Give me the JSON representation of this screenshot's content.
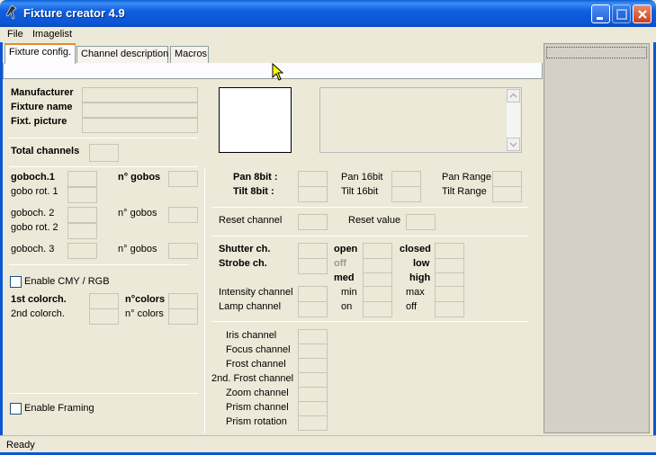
{
  "window": {
    "title": "Fixture creator 4.9"
  },
  "menu": [
    "File",
    "Imagelist"
  ],
  "tabs": [
    "Fixture config.",
    "Channel description",
    "Macros"
  ],
  "general": {
    "manufacturer": "Manufacturer",
    "fixture_name": "Fixture name",
    "fixture_picture": "Fixt. picture",
    "total_channels": "Total channels"
  },
  "gobo": {
    "goboch1": "goboch.1",
    "gobo_rot1": "gobo rot. 1",
    "n_gobos_1": "n° gobos",
    "goboch2": "goboch. 2",
    "gobo_rot2": "gobo rot. 2",
    "n_gobos_2": "n° gobos",
    "goboch3": "goboch. 3",
    "n_gobos_3": "n° gobos"
  },
  "color": {
    "enable_cmy": "Enable CMY / RGB",
    "colorch1": "1st colorch.",
    "colorch2": "2nd colorch.",
    "ncolors1": "n°colors",
    "ncolors2": "n° colors"
  },
  "framing": {
    "enable": "Enable Framing"
  },
  "pantilt": {
    "pan8": "Pan 8bit :",
    "tilt8": "Tilt 8bit :",
    "pan16": "Pan 16bit",
    "tilt16": "Tilt 16bit",
    "pan_range": "Pan Range",
    "tilt_range": "Tilt Range"
  },
  "reset": {
    "channel": "Reset channel",
    "value": "Reset value"
  },
  "shutter": {
    "shutter_ch": "Shutter ch.",
    "strobe_ch": "Strobe ch.",
    "open": "open",
    "off_gray": "off",
    "med": "med",
    "closed": "closed",
    "low": "low",
    "high": "high",
    "intensity": "Intensity channel",
    "lamp": "Lamp channel",
    "min": "min",
    "on": "on",
    "max": "max",
    "off": "off"
  },
  "channels": [
    "Iris channel",
    "Focus channel",
    "Frost channel",
    "2nd. Frost channel",
    "Zoom channel",
    "Prism channel",
    "Prism rotation"
  ],
  "status": "Ready",
  "colors": {
    "title_blue": "#0b56d4",
    "tab_accent": "#e68b2c"
  }
}
